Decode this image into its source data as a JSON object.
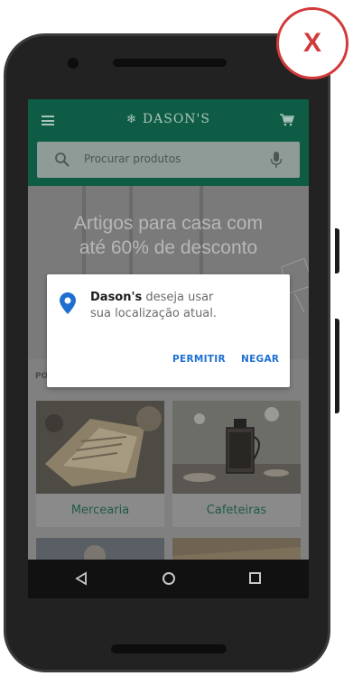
{
  "badge": {
    "text": "X",
    "color": "#d23a3a"
  },
  "header": {
    "brand": "DASON'S",
    "menu_icon": "menu-icon",
    "cart_icon": "cart-icon",
    "color": "#0f5c46"
  },
  "search": {
    "placeholder": "Procurar produtos",
    "search_icon": "search-icon",
    "mic_icon": "mic-icon"
  },
  "hero": {
    "title_line1": "Artigos para casa com",
    "title_line2": "até 60% de desconto"
  },
  "section": {
    "label": "PO"
  },
  "categories": [
    {
      "label": "Mercearia"
    },
    {
      "label": "Cafeteiras"
    }
  ],
  "navbar": {
    "back_icon": "back-icon",
    "home_icon": "home-icon",
    "recent_icon": "recent-apps-icon"
  },
  "dialog": {
    "app_name": "Dason's",
    "message_part1": " deseja usar",
    "message_part2": "sua localização atual.",
    "allow_label": "PERMITIR",
    "deny_label": "NEGAR",
    "accent": "#1f6fd1"
  }
}
